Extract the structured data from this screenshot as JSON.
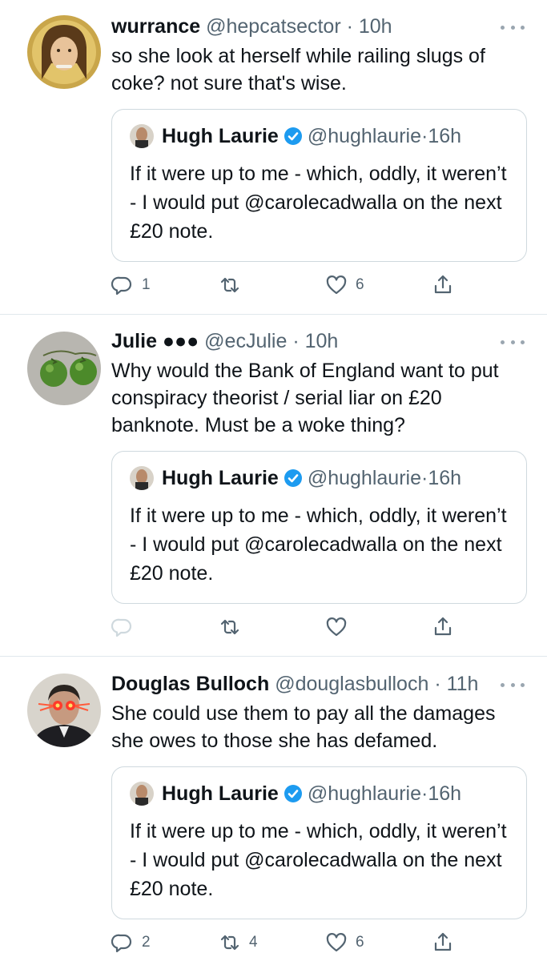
{
  "tweets": [
    {
      "name": "wurrance",
      "handle": "@hepcatsector",
      "time": "10h",
      "text": "so she look at herself while railing slugs of coke? not sure that's wise.",
      "quote": {
        "name": "Hugh Laurie",
        "handle": "@hughlaurie",
        "time": "16h",
        "text": "If it were up to me - which, oddly, it weren’t - I would put @carolecadwalla on the next £20 note."
      },
      "replies": "1",
      "retweets": "",
      "likes": "6"
    },
    {
      "name": "Julie ●●●",
      "handle": "@ecJulie",
      "time": "10h",
      "text": "Why would the Bank of England want to put conspiracy theorist / serial liar on £20 banknote. Must be a woke thing?",
      "quote": {
        "name": "Hugh Laurie",
        "handle": "@hughlaurie",
        "time": "16h",
        "text": "If it were up to me - which, oddly, it weren’t - I would put @carolecadwalla on the next £20 note."
      },
      "replies": "",
      "retweets": "",
      "likes": ""
    },
    {
      "name": "Douglas Bulloch",
      "handle": "@douglasbulloch",
      "time": "11h",
      "text": "She could use them to pay all the damages she owes to those she has defamed.",
      "quote": {
        "name": "Hugh Laurie",
        "handle": "@hughlaurie",
        "time": "16h",
        "text": "If it were up to me - which, oddly, it weren’t - I would put @carolecadwalla on the next £20 note."
      },
      "replies": "2",
      "retweets": "4",
      "likes": "6"
    }
  ],
  "icons": {
    "reply": "reply-icon",
    "retweet": "retweet-icon",
    "like": "heart-icon",
    "share": "share-icon",
    "more": "more-icon",
    "verified": "verified-badge-icon"
  },
  "colors": {
    "text": "#0f1419",
    "secondary": "#536471",
    "verified": "#1d9bf0",
    "divider": "#e1e8ed",
    "quote_border": "#cfd9de"
  }
}
